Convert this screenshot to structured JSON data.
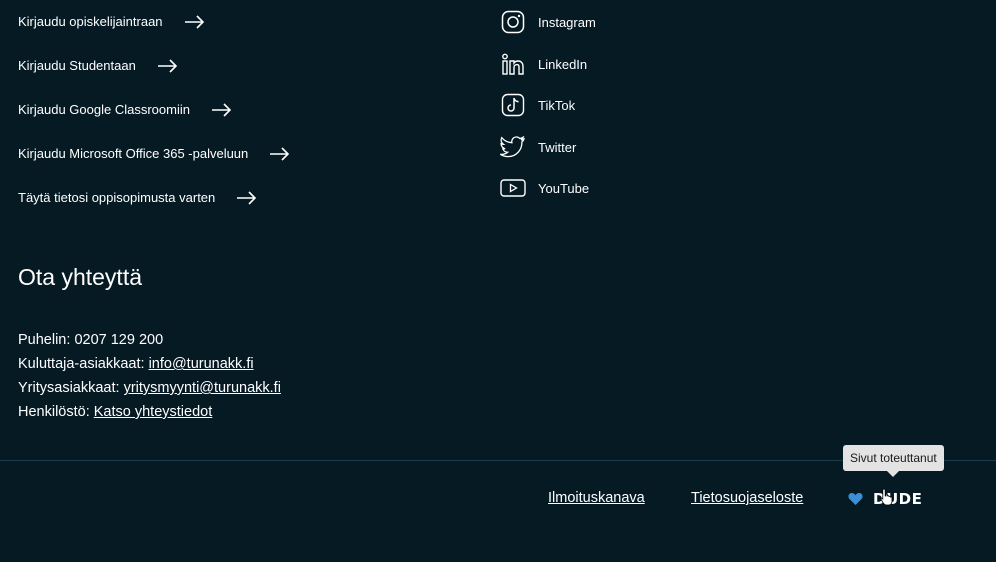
{
  "login_links": [
    {
      "label": "Kirjaudu opiskelijaintraan"
    },
    {
      "label": "Kirjaudu Studentaan"
    },
    {
      "label": "Kirjaudu Google Classroomiin"
    },
    {
      "label": "Kirjaudu Microsoft Office 365 -palveluun"
    },
    {
      "label": "Täytä tietosi oppisopimusta varten"
    }
  ],
  "social_links": [
    {
      "label": "Instagram",
      "icon": "instagram-icon"
    },
    {
      "label": "LinkedIn",
      "icon": "linkedin-icon"
    },
    {
      "label": "TikTok",
      "icon": "tiktok-icon"
    },
    {
      "label": "Twitter",
      "icon": "twitter-icon"
    },
    {
      "label": "YouTube",
      "icon": "youtube-icon"
    }
  ],
  "contact": {
    "title": "Ota yhteyttä",
    "phone_label": "Puhelin: ",
    "phone_value": "0207 129 200",
    "consumer_label": "Kuluttaja-asiakkaat: ",
    "consumer_email": "info@turunakk.fi",
    "business_label": "Yritysasiakkaat: ",
    "business_email": "yritysmyynti@turunakk.fi",
    "staff_label": "Henkilöstö: ",
    "staff_link": "Katso yhteystiedot"
  },
  "footer": {
    "link_report": "Ilmoituskanava",
    "link_privacy": "Tietosuojaseloste",
    "credit_logo_text": "DUDE",
    "tooltip": "Sivut toteuttanut"
  },
  "colors": {
    "background": "#061a24",
    "text": "#ffffff",
    "heart": "#3a8fd8",
    "divider": "#1d3a48",
    "tooltip_bg": "#e3e3e3"
  }
}
